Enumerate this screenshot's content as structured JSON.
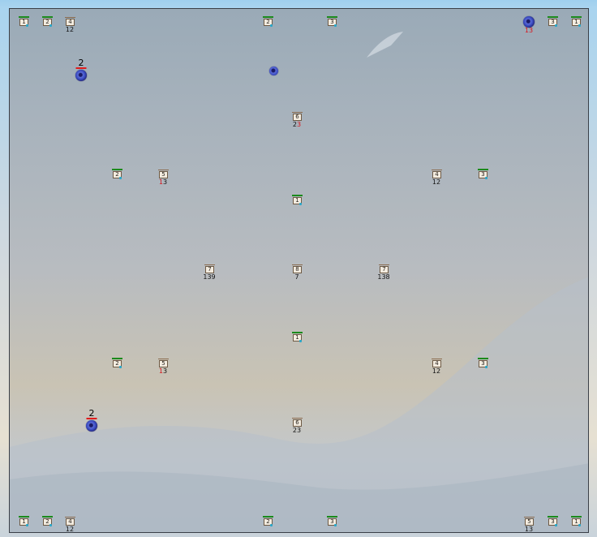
{
  "map": {
    "units": [
      {
        "id": "u-tl-1",
        "type": "gem",
        "bar": "green",
        "label": "1"
      },
      {
        "id": "u-tl-2",
        "type": "gem",
        "bar": "green",
        "label": "2"
      },
      {
        "id": "u-tl-3",
        "type": "crate",
        "bar": "brown",
        "label": "4",
        "count": "12"
      },
      {
        "id": "u-t-1",
        "type": "gem",
        "bar": "green",
        "label": "2"
      },
      {
        "id": "u-t-2",
        "type": "gem",
        "bar": "green",
        "label": "3"
      },
      {
        "id": "u-tr-2",
        "type": "gem",
        "bar": "green",
        "label": "3"
      },
      {
        "id": "u-tr-3",
        "type": "gem",
        "bar": "green",
        "label": "1"
      },
      {
        "id": "u-c-1",
        "type": "crate",
        "bar": "brown",
        "label": "6",
        "count": "23",
        "count_red_suffix": "3"
      },
      {
        "id": "u-ml-1",
        "type": "gem",
        "bar": "green",
        "label": "2"
      },
      {
        "id": "u-ml-2",
        "type": "crate",
        "bar": "brown",
        "label": "5",
        "count": "13",
        "count_red_prefix": "1"
      },
      {
        "id": "u-mr-1",
        "type": "crate",
        "bar": "brown",
        "label": "4",
        "count": "12"
      },
      {
        "id": "u-mr-2",
        "type": "gem",
        "bar": "green",
        "label": "3"
      },
      {
        "id": "u-mc-1",
        "type": "gem",
        "bar": "green",
        "label": "1"
      },
      {
        "id": "u-cl",
        "type": "crate",
        "bar": "brown",
        "label": "7",
        "count": "139"
      },
      {
        "id": "u-cc",
        "type": "crate",
        "bar": "brown",
        "label": "8",
        "count": "7"
      },
      {
        "id": "u-cr",
        "type": "crate",
        "bar": "brown",
        "label": "7",
        "count": "138"
      },
      {
        "id": "u-mc-2",
        "type": "gem",
        "bar": "green",
        "label": "1"
      },
      {
        "id": "u-bl-1",
        "type": "gem",
        "bar": "green",
        "label": "2"
      },
      {
        "id": "u-bl-2",
        "type": "crate",
        "bar": "brown",
        "label": "5",
        "count": "13",
        "count_red_prefix": "1"
      },
      {
        "id": "u-br-1",
        "type": "crate",
        "bar": "brown",
        "label": "4",
        "count": "12"
      },
      {
        "id": "u-br-2",
        "type": "gem",
        "bar": "green",
        "label": "3"
      },
      {
        "id": "u-bc-1",
        "type": "crate",
        "bar": "brown",
        "label": "6",
        "count": "23"
      },
      {
        "id": "u-bot-1",
        "type": "gem",
        "bar": "green",
        "label": "1"
      },
      {
        "id": "u-bot-2",
        "type": "gem",
        "bar": "green",
        "label": "2"
      },
      {
        "id": "u-bot-3",
        "type": "crate",
        "bar": "brown",
        "label": "4",
        "count": "12"
      },
      {
        "id": "u-bot-4",
        "type": "gem",
        "bar": "green",
        "label": "2"
      },
      {
        "id": "u-bot-5",
        "type": "gem",
        "bar": "green",
        "label": "3"
      },
      {
        "id": "u-bot-6",
        "type": "crate",
        "bar": "brown",
        "label": "5",
        "count": "13"
      },
      {
        "id": "u-bot-7",
        "type": "gem",
        "bar": "green",
        "label": "3"
      },
      {
        "id": "u-bot-8",
        "type": "gem",
        "bar": "green",
        "label": "1"
      }
    ],
    "players": [
      {
        "id": "p-1",
        "label": "2",
        "size": "large",
        "bar": true
      },
      {
        "id": "p-2",
        "label": "",
        "size": "small",
        "bar": false
      },
      {
        "id": "p-3",
        "label": "",
        "size": "large",
        "bar": false,
        "count": "13",
        "count_red_suffix": "3"
      },
      {
        "id": "p-4",
        "label": "2",
        "size": "large",
        "bar": true
      }
    ]
  },
  "colors": {
    "player_orb": "#3343b8",
    "player_bar": "#e01b1b",
    "gem_bar": "#1b8a1b",
    "highlight_text": "#d8131b"
  }
}
